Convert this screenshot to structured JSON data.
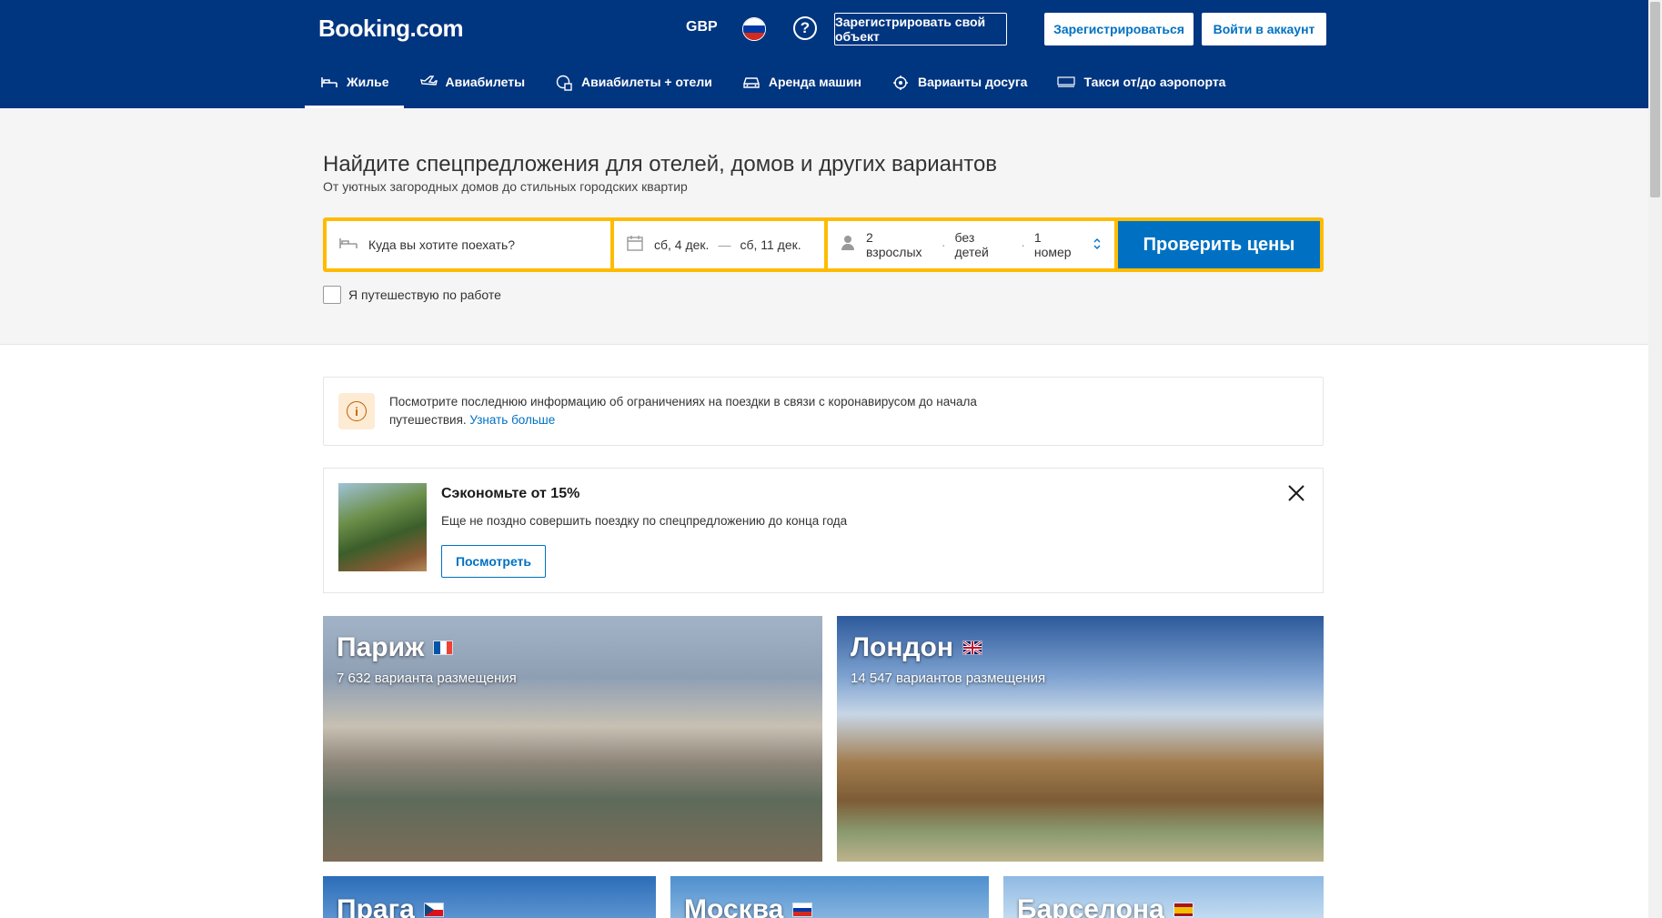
{
  "header": {
    "logo": "Booking.com",
    "currency": "GBP",
    "help_icon": "question-circle-icon",
    "list_property": "Зарегистрировать свой объект",
    "register": "Зарегистрироваться",
    "sign_in": "Войти в аккаунт",
    "colors": {
      "background": "#003580",
      "link": "#0071c2"
    }
  },
  "nav": {
    "items": [
      {
        "label": "Жилье",
        "icon": "bed-icon",
        "active": true
      },
      {
        "label": "Авиабилеты",
        "icon": "plane-icon"
      },
      {
        "label": "Авиабилеты + отели",
        "icon": "plane-hotel-icon"
      },
      {
        "label": "Аренда машин",
        "icon": "car-icon"
      },
      {
        "label": "Варианты досуга",
        "icon": "attractions-icon"
      },
      {
        "label": "Такси от/до аэропорта",
        "icon": "taxi-icon"
      }
    ]
  },
  "hero": {
    "title": "Найдите спецпредложения для отелей, домов и других вариантов",
    "subtitle": "От уютных загородных домов до стильных городских квартир",
    "search": {
      "destination_placeholder": "Куда вы хотите поехать?",
      "checkin": "сб, 4 дек.",
      "dash": "—",
      "checkout": "сб, 11 дек.",
      "adults": "2 взрослых",
      "children": "без детей",
      "rooms": "1 номер",
      "dot": "·",
      "submit": "Проверить цены"
    },
    "work_travel": "Я путешествую по работе"
  },
  "alert": {
    "text": "Посмотрите последнюю информацию об ограничениях на поездки в связи с коронавирусом до начала путешествия.",
    "link": "Узнать больше"
  },
  "promo": {
    "title": "Сэкономьте от 15%",
    "text": "Еще не поздно совершить поездку по спецпредложению до конца года",
    "button": "Посмотреть"
  },
  "destinations": [
    {
      "name": "Париж",
      "count": "7 632 варианта размещения"
    },
    {
      "name": "Лондон",
      "count": "14 547 вариантов размещения"
    },
    {
      "name": "Прага"
    },
    {
      "name": "Москва"
    },
    {
      "name": "Барселона"
    }
  ]
}
